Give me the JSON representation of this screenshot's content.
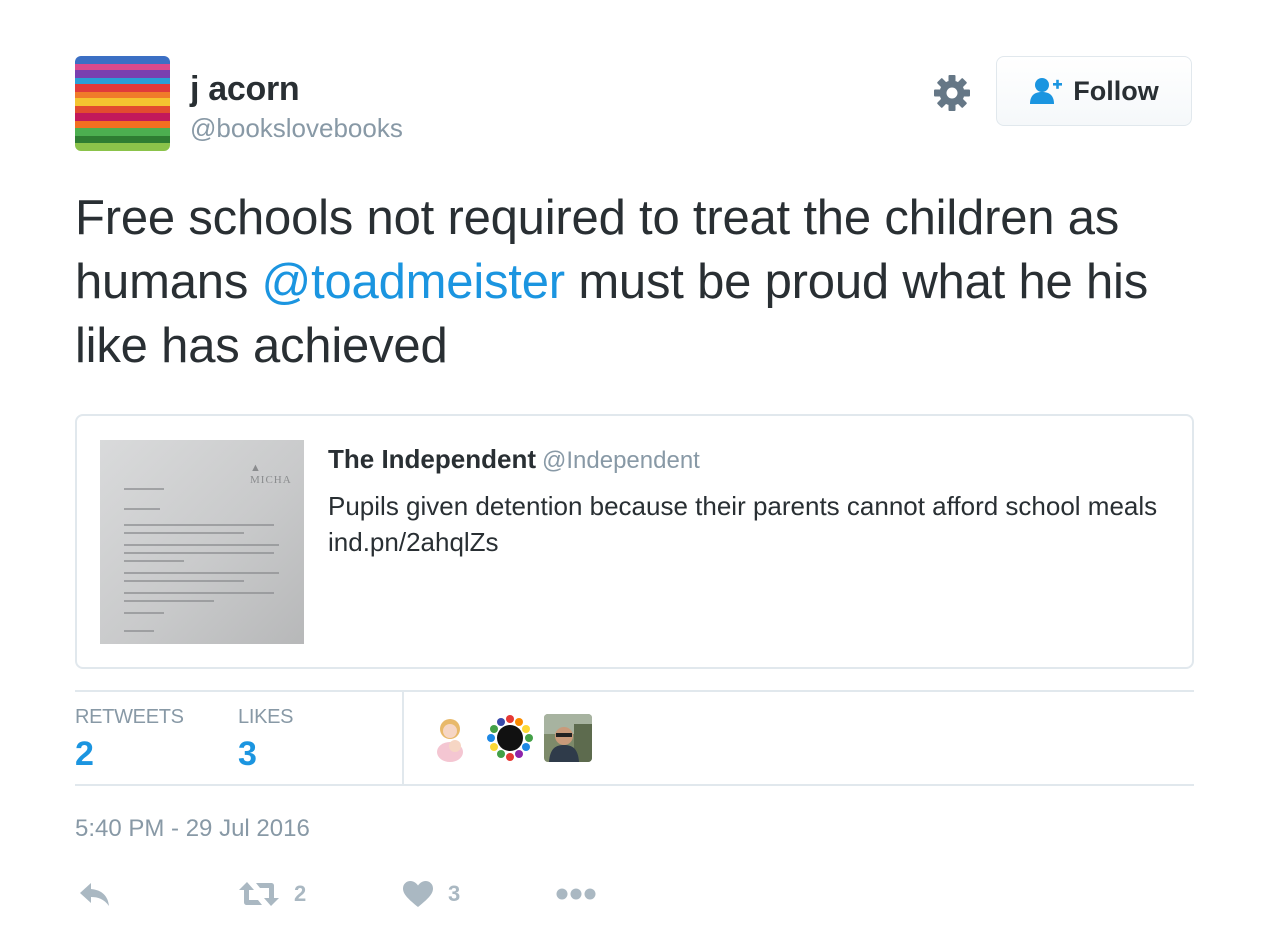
{
  "user": {
    "display_name": "j acorn",
    "handle": "@bookslovebooks"
  },
  "follow_button": {
    "label": "Follow"
  },
  "tweet": {
    "text_before": "Free schools not required to treat the children as humans ",
    "mention": "@toadmeister",
    "text_after": " must be proud what he his like has achieved"
  },
  "quoted_tweet": {
    "name": "The Independent",
    "handle": "@Independent",
    "text": "Pupils given detention because their parents cannot afford school meals ind.pn/2ahqlZs"
  },
  "stats": {
    "retweets_label": "RETWEETS",
    "retweets_value": "2",
    "likes_label": "LIKES",
    "likes_value": "3"
  },
  "timestamp": "5:40 PM - 29 Jul 2016",
  "actions": {
    "retweet_count": "2",
    "like_count": "3"
  },
  "colors": {
    "accent": "#1b95e0",
    "muted": "#8899a6",
    "border": "#e1e8ed",
    "action_icon": "#aab8c2"
  }
}
